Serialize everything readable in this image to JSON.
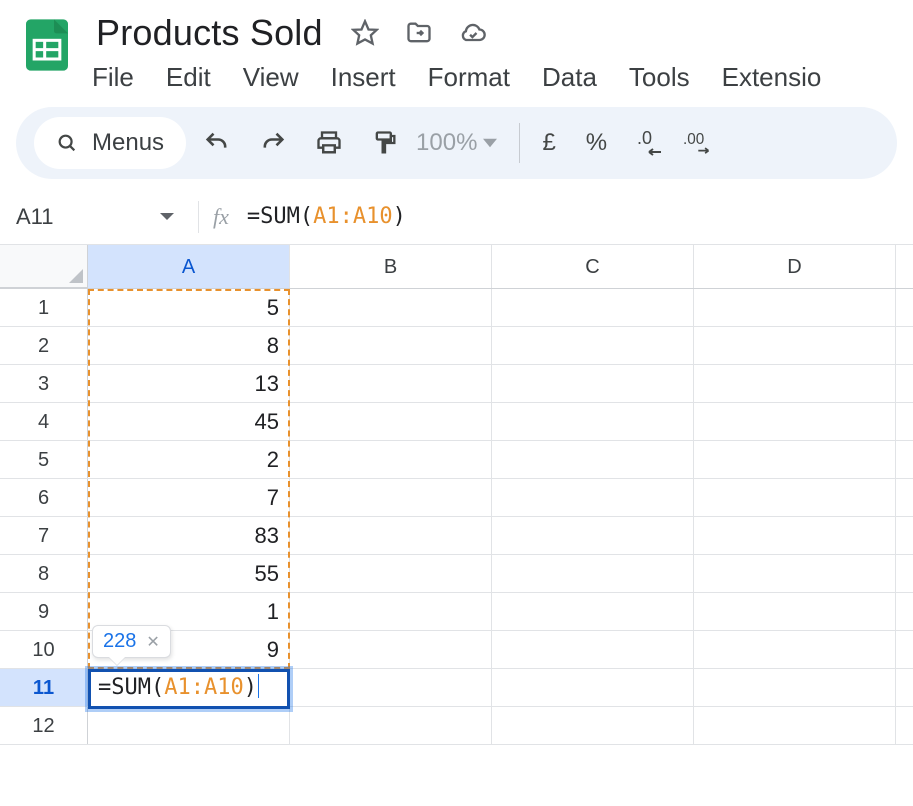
{
  "header": {
    "title": "Products Sold",
    "menus": [
      "File",
      "Edit",
      "View",
      "Insert",
      "Format",
      "Data",
      "Tools",
      "Extensio"
    ]
  },
  "toolbar": {
    "menus_label": "Menus",
    "zoom": "100%",
    "currency": "£",
    "percent": "%",
    "dec_decrease": ".0",
    "dec_increase": ".00"
  },
  "formula_bar": {
    "namebox": "A11",
    "formula_prefix": "=SUM(",
    "formula_range": "A1:A10",
    "formula_suffix": ")"
  },
  "grid": {
    "columns": [
      "A",
      "B",
      "C",
      "D"
    ],
    "selected_column_index": 0,
    "row_headers": [
      "1",
      "2",
      "3",
      "4",
      "5",
      "6",
      "7",
      "8",
      "9",
      "10",
      "11",
      "12"
    ],
    "active_row_index": 10,
    "colA": [
      "5",
      "8",
      "13",
      "45",
      "2",
      "7",
      "83",
      "55",
      "1",
      "9"
    ],
    "editing_cell": {
      "row_index": 10,
      "col_index": 0,
      "prefix": "=SUM(",
      "range": "A1:A10",
      "suffix": ")"
    },
    "tooltip_value": "228"
  },
  "chart_data": {
    "type": "table",
    "title": "Products Sold",
    "columns": [
      "A"
    ],
    "rows": [
      {
        "row": 1,
        "A": 5
      },
      {
        "row": 2,
        "A": 8
      },
      {
        "row": 3,
        "A": 13
      },
      {
        "row": 4,
        "A": 45
      },
      {
        "row": 5,
        "A": 2
      },
      {
        "row": 6,
        "A": 7
      },
      {
        "row": 7,
        "A": 83
      },
      {
        "row": 8,
        "A": 55
      },
      {
        "row": 9,
        "A": 1
      },
      {
        "row": 10,
        "A": 9
      }
    ],
    "formula_cell": {
      "ref": "A11",
      "formula": "=SUM(A1:A10)",
      "preview_result": 228
    }
  }
}
